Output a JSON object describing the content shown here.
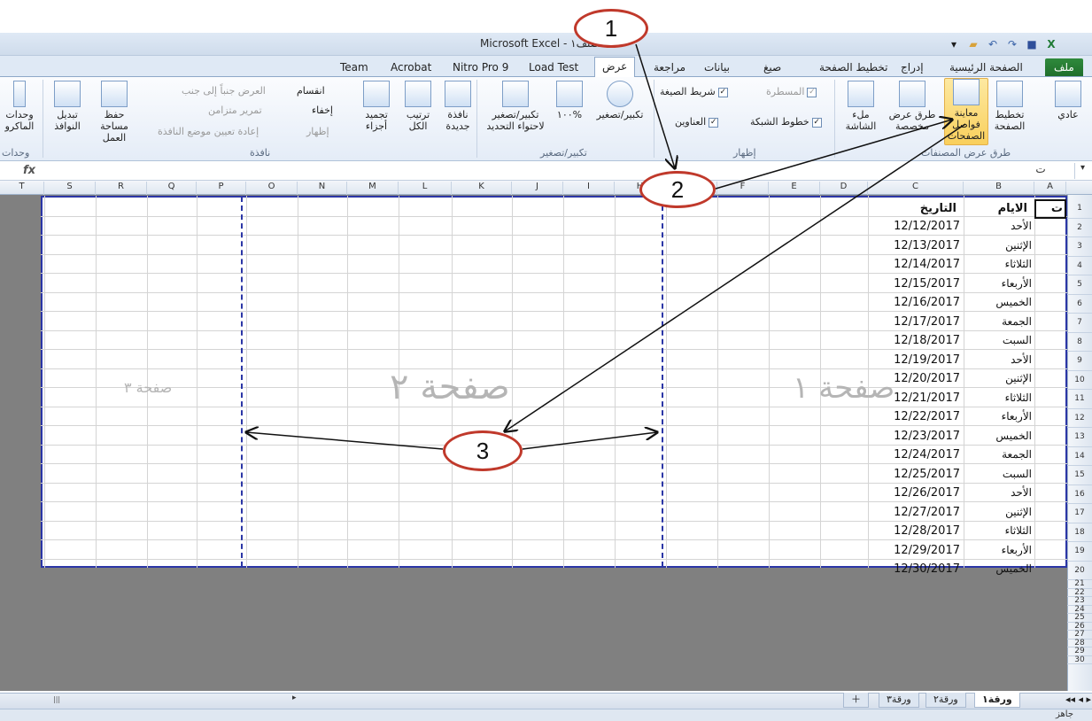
{
  "window": {
    "title": "Microsoft Excel - المصنف١"
  },
  "ribbon_tabs": [
    "ملف",
    "الصفحة الرئيسية",
    "إدراج",
    "تخطيط الصفحة",
    "صيغ",
    "بيانات",
    "مراجعة",
    "عرض",
    "Load Test",
    "Nitro Pro 9",
    "Acrobat",
    "Team"
  ],
  "ribbon": {
    "views": {
      "normal": "عادي",
      "page_layout": "تخطيط الصفحة",
      "page_break_preview": "معاينة فواصل الصفحات",
      "custom_views": "طرق عرض مخصصة",
      "full_screen": "ملء الشاشة",
      "group_label": "طرق عرض المصنفات"
    },
    "show": {
      "ruler": "المسطرة",
      "formula_bar": "شريط الصيغة",
      "gridlines": "خطوط الشبكة",
      "headings": "العناوين",
      "group_label": "إظهار"
    },
    "zoom": {
      "zoom": "تكبير/تصغير",
      "hundred": "١٠٠%",
      "zoom_selection": "تكبير/تصغير لاحتواء التحديد",
      "group_label": "تكبير/تصغير"
    },
    "window": {
      "new_window": "نافذة جديدة",
      "arrange_all": "ترتيب الكل",
      "freeze_panes": "تجميد أجزاء",
      "split": "انقسام",
      "hide": "إخفاء",
      "unhide": "إظهار",
      "side_by_side": "العرض جنباً إلى جنب",
      "sync_scroll": "تمرير متزامن",
      "reset_position": "إعادة تعيين موضع النافذة",
      "save_workspace": "حفظ مساحة العمل",
      "switch_windows": "تبديل النوافذ",
      "group_label": "نافذة"
    },
    "macros": {
      "label": "وحدات الماكرو",
      "group_label": "وحدات"
    }
  },
  "formula_bar": {
    "fx": "fx",
    "name_box": "ت"
  },
  "columns": [
    "A",
    "B",
    "C",
    "D",
    "E",
    "F",
    "G",
    "H",
    "I",
    "J",
    "K",
    "L",
    "M",
    "N",
    "O",
    "P",
    "Q",
    "R",
    "S",
    "T"
  ],
  "rows": [
    "1",
    "2",
    "3",
    "4",
    "5",
    "6",
    "7",
    "8",
    "9",
    "10",
    "11",
    "12",
    "13",
    "14",
    "15",
    "16",
    "17",
    "18",
    "19",
    "20",
    "21",
    "22",
    "23",
    "24",
    "25",
    "26",
    "27",
    "28",
    "29",
    "30"
  ],
  "table": {
    "col_a_header": "ت",
    "col_b_header": "الايام",
    "col_c_header": "التاريخ",
    "entries": [
      {
        "day": "الأحد",
        "date": "12/12/2017"
      },
      {
        "day": "الإثنين",
        "date": "12/13/2017"
      },
      {
        "day": "الثلاثاء",
        "date": "12/14/2017"
      },
      {
        "day": "الأربعاء",
        "date": "12/15/2017"
      },
      {
        "day": "الخميس",
        "date": "12/16/2017"
      },
      {
        "day": "الجمعة",
        "date": "12/17/2017"
      },
      {
        "day": "السبت",
        "date": "12/18/2017"
      },
      {
        "day": "الأحد",
        "date": "12/19/2017"
      },
      {
        "day": "الإثنين",
        "date": "12/20/2017"
      },
      {
        "day": "الثلاثاء",
        "date": "12/21/2017"
      },
      {
        "day": "الأربعاء",
        "date": "12/22/2017"
      },
      {
        "day": "الخميس",
        "date": "12/23/2017"
      },
      {
        "day": "الجمعة",
        "date": "12/24/2017"
      },
      {
        "day": "السبت",
        "date": "12/25/2017"
      },
      {
        "day": "الأحد",
        "date": "12/26/2017"
      },
      {
        "day": "الإثنين",
        "date": "12/27/2017"
      },
      {
        "day": "الثلاثاء",
        "date": "12/28/2017"
      },
      {
        "day": "الأربعاء",
        "date": "12/29/2017"
      },
      {
        "day": "الخميس",
        "date": "12/30/2017"
      }
    ]
  },
  "page_watermarks": [
    "صفحة ١",
    "صفحة ٢",
    "صفحة ٣"
  ],
  "sheet_tabs": [
    "ورقة١",
    "ورقة٢",
    "ورقة٣"
  ],
  "status": {
    "text": "جاهز"
  },
  "annotations": [
    "1",
    "2",
    "3"
  ]
}
